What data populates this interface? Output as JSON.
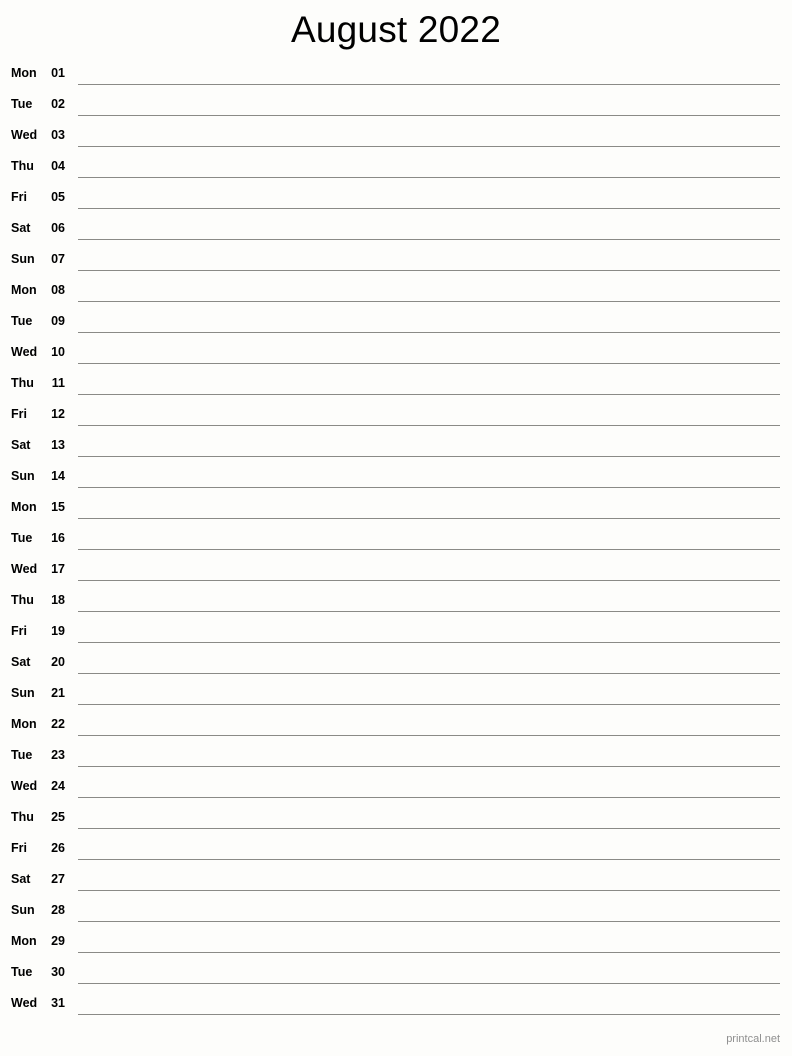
{
  "page": {
    "title": "August 2022",
    "month": "August",
    "year": "2022",
    "footer": "printcal.net",
    "line_color": "#8a8a86",
    "background_color": "#fdfdfb",
    "text_color": "#000000",
    "footer_color": "#8f8f8f"
  },
  "rows": [
    {
      "weekday": "Mon",
      "date": "01"
    },
    {
      "weekday": "Tue",
      "date": "02"
    },
    {
      "weekday": "Wed",
      "date": "03"
    },
    {
      "weekday": "Thu",
      "date": "04"
    },
    {
      "weekday": "Fri",
      "date": "05"
    },
    {
      "weekday": "Sat",
      "date": "06"
    },
    {
      "weekday": "Sun",
      "date": "07"
    },
    {
      "weekday": "Mon",
      "date": "08"
    },
    {
      "weekday": "Tue",
      "date": "09"
    },
    {
      "weekday": "Wed",
      "date": "10"
    },
    {
      "weekday": "Thu",
      "date": "11"
    },
    {
      "weekday": "Fri",
      "date": "12"
    },
    {
      "weekday": "Sat",
      "date": "13"
    },
    {
      "weekday": "Sun",
      "date": "14"
    },
    {
      "weekday": "Mon",
      "date": "15"
    },
    {
      "weekday": "Tue",
      "date": "16"
    },
    {
      "weekday": "Wed",
      "date": "17"
    },
    {
      "weekday": "Thu",
      "date": "18"
    },
    {
      "weekday": "Fri",
      "date": "19"
    },
    {
      "weekday": "Sat",
      "date": "20"
    },
    {
      "weekday": "Sun",
      "date": "21"
    },
    {
      "weekday": "Mon",
      "date": "22"
    },
    {
      "weekday": "Tue",
      "date": "23"
    },
    {
      "weekday": "Wed",
      "date": "24"
    },
    {
      "weekday": "Thu",
      "date": "25"
    },
    {
      "weekday": "Fri",
      "date": "26"
    },
    {
      "weekday": "Sat",
      "date": "27"
    },
    {
      "weekday": "Sun",
      "date": "28"
    },
    {
      "weekday": "Mon",
      "date": "29"
    },
    {
      "weekday": "Tue",
      "date": "30"
    },
    {
      "weekday": "Wed",
      "date": "31"
    }
  ]
}
